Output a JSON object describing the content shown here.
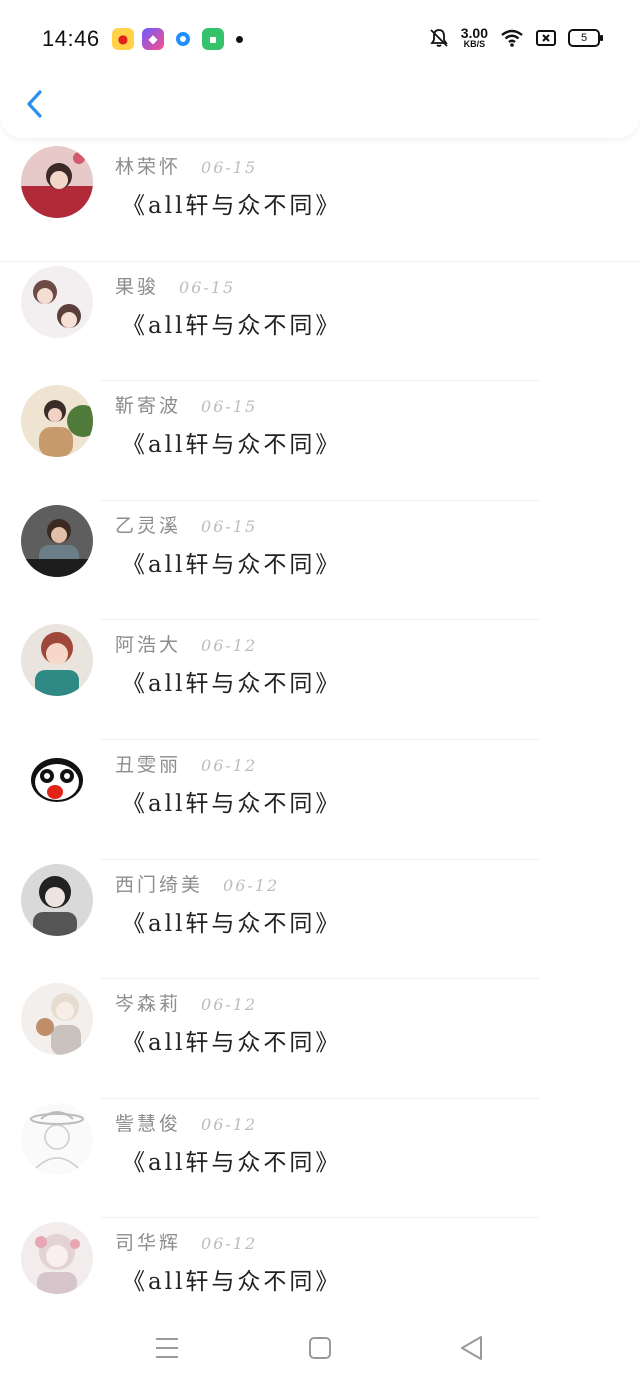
{
  "status_bar": {
    "time": "14:46",
    "net_speed_value": "3.00",
    "net_speed_unit": "KB/S",
    "battery": "5",
    "app_icons": [
      "weibo-icon",
      "shortcuts-icon",
      "qq-browser-icon",
      "app-store-icon"
    ]
  },
  "header": {
    "back_icon": "chevron-left-icon"
  },
  "comments": [
    {
      "name": "林荣怀",
      "date": "06-15",
      "text": "《all轩与众不同》"
    },
    {
      "name": "果骏",
      "date": "06-15",
      "text": "《all轩与众不同》"
    },
    {
      "name": "靳寄波",
      "date": "06-15",
      "text": "《all轩与众不同》"
    },
    {
      "name": "乙灵溪",
      "date": "06-15",
      "text": "《all轩与众不同》"
    },
    {
      "name": "阿浩大",
      "date": "06-12",
      "text": "《all轩与众不同》"
    },
    {
      "name": "丑雯丽",
      "date": "06-12",
      "text": "《all轩与众不同》"
    },
    {
      "name": "西门绮美",
      "date": "06-12",
      "text": "《all轩与众不同》"
    },
    {
      "name": "岑森莉",
      "date": "06-12",
      "text": "《all轩与众不同》"
    },
    {
      "name": "訾慧俊",
      "date": "06-12",
      "text": "《all轩与众不同》"
    },
    {
      "name": "司华辉",
      "date": "06-12",
      "text": "《all轩与众不同》"
    }
  ],
  "colors": {
    "accent": "#2d8ff0",
    "name": "#8d8d8d",
    "date": "#bdbdbd",
    "text": "#222222"
  },
  "nav_bar": {
    "icons": [
      "menu-icon",
      "home-square-icon",
      "back-triangle-icon"
    ]
  }
}
